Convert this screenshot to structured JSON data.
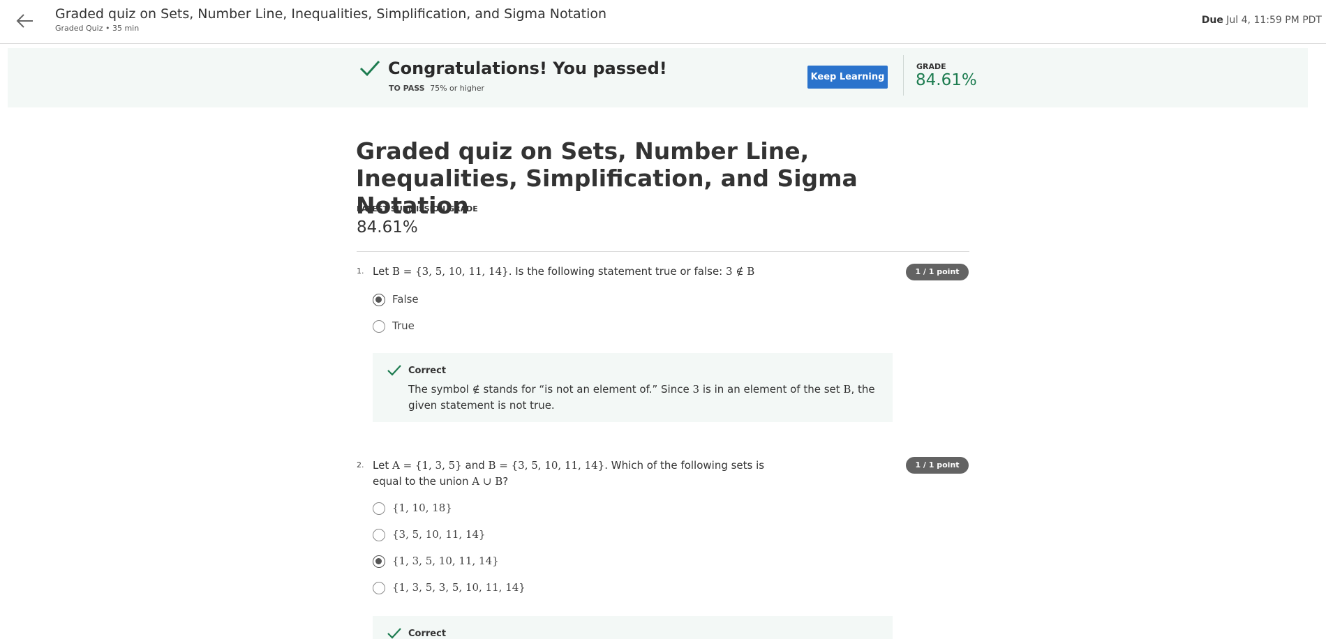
{
  "header": {
    "title": "Graded quiz on Sets, Number Line, Inequalities, Simplification, and Sigma Notation",
    "subtitle": "Graded Quiz • 35 min",
    "due_label": "Due",
    "due_value": "Jul 4, 11:59 PM PDT"
  },
  "banner": {
    "title": "Congratulations! You passed!",
    "to_pass_label": "TO PASS",
    "to_pass_value": "75% or higher",
    "keep_learning": "Keep Learning",
    "grade_label": "GRADE",
    "grade_value": "84.61%"
  },
  "main": {
    "title": "Graded quiz on Sets, Number Line, Inequalities, Simplification, and Sigma Notation",
    "latest_grade_label": "LATEST SUBMISSION GRADE",
    "latest_grade_value": "84.61%"
  },
  "questions": [
    {
      "number": "1.",
      "text_prefix": "Let",
      "text_math1": "B = {3, 5, 10, 11, 14}",
      "text_mid": ". Is the following statement true or false:",
      "text_math2": "3 ∉ B",
      "points": "1 / 1 point",
      "options": [
        {
          "label": "False",
          "selected": true
        },
        {
          "label": "True",
          "selected": false
        }
      ],
      "feedback": {
        "head": "Correct",
        "t1": "The symbol",
        "m1": "∉",
        "t2": "stands for “is not an element of.” Since",
        "m2": "3",
        "t3": "is in an element of the set",
        "m3": "B",
        "t4": ", the given statement is not true."
      }
    },
    {
      "number": "2.",
      "text_prefix": "Let",
      "text_math1": "A = {1, 3, 5}",
      "text_and": "and",
      "text_math2": "B = {3, 5, 10, 11, 14}",
      "text_mid": ". Which of the following sets is equal",
      "text_line2": "to the union",
      "text_math3": "A ∪ B",
      "text_end": "?",
      "points": "1 / 1 point",
      "options": [
        {
          "label": "{1, 10, 18}",
          "selected": false
        },
        {
          "label": "{3, 5, 10, 11, 14}",
          "selected": false
        },
        {
          "label": "{1, 3, 5, 10, 11, 14}",
          "selected": true
        },
        {
          "label": "{1, 3, 5, 3, 5, 10, 11, 14}",
          "selected": false
        }
      ],
      "feedback": {
        "head": "Correct"
      }
    }
  ],
  "colors": {
    "accent_button": "#2a73cc",
    "success_green": "#1d7c50",
    "banner_bg": "#f3f8f6",
    "badge_bg": "#636363"
  }
}
